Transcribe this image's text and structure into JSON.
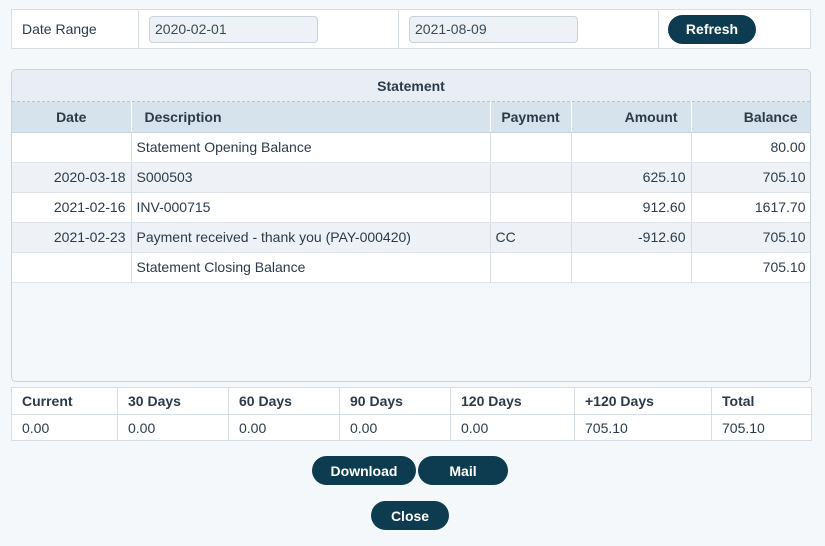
{
  "range": {
    "label": "Date Range",
    "from": "2020-02-01",
    "to": "2021-08-09",
    "refresh_label": "Refresh"
  },
  "statement": {
    "title": "Statement",
    "columns": [
      "Date",
      "Description",
      "Payment",
      "Amount",
      "Balance"
    ],
    "rows": [
      {
        "date": "",
        "description": "Statement Opening Balance",
        "payment": "",
        "amount": "",
        "balance": "80.00"
      },
      {
        "date": "2020-03-18",
        "description": "S000503",
        "payment": "",
        "amount": "625.10",
        "balance": "705.10"
      },
      {
        "date": "2021-02-16",
        "description": "INV-000715",
        "payment": "",
        "amount": "912.60",
        "balance": "1617.70"
      },
      {
        "date": "2021-02-23",
        "description": "Payment received - thank you (PAY-000420)",
        "payment": "CC",
        "amount": "-912.60",
        "balance": "705.10"
      },
      {
        "date": "",
        "description": "Statement Closing Balance",
        "payment": "",
        "amount": "",
        "balance": "705.10"
      }
    ]
  },
  "aging": {
    "headers": [
      "Current",
      "30 Days",
      "60 Days",
      "90 Days",
      "120 Days",
      "+120 Days",
      "Total"
    ],
    "values": [
      "0.00",
      "0.00",
      "0.00",
      "0.00",
      "0.00",
      "705.10",
      "705.10"
    ]
  },
  "actions": {
    "download_label": "Download",
    "mail_label": "Mail",
    "close_label": "Close"
  },
  "colors": {
    "button_bg": "#0d3b4f",
    "header_bg": "#d6e3ec"
  }
}
